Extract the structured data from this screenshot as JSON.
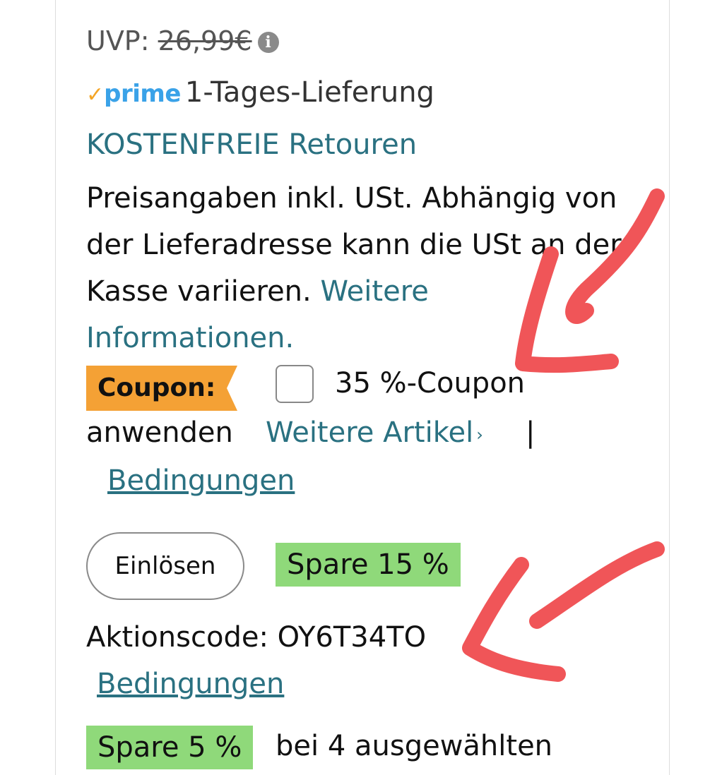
{
  "price": {
    "uvp_label": "UVP:",
    "uvp_value": "26,99€",
    "info_icon": "info-icon"
  },
  "delivery": {
    "prime_label": "prime",
    "prime_check_icon": "check-icon",
    "delivery_text": "1-Tages-Lieferung",
    "returns_link": "KOSTENFREIE Retouren"
  },
  "vat": {
    "text": "Preisangaben inkl. USt. Abhängig von der Lieferadresse kann die USt an der Kasse variieren.",
    "link": "Weitere Informationen."
  },
  "coupon": {
    "badge": "Coupon:",
    "text": "35 %-Coupon",
    "text2": "anwenden",
    "more_link": "Weitere Artikel",
    "chevron": "›",
    "separator": "|",
    "terms_link": "Bedingungen",
    "checked": false
  },
  "promo": {
    "redeem_button": "Einlösen",
    "save_badge": "Spare 15 %",
    "code_label": "Aktionscode: OY6T34TO",
    "terms_link": "Bedingungen"
  },
  "promo2": {
    "save_badge": "Spare 5 %",
    "text": "bei 4 ausgewählten"
  },
  "colors": {
    "link": "#2a7181",
    "coupon_badge": "#f4a135",
    "save_badge": "#8fd97a",
    "annotation": "#f05558"
  }
}
